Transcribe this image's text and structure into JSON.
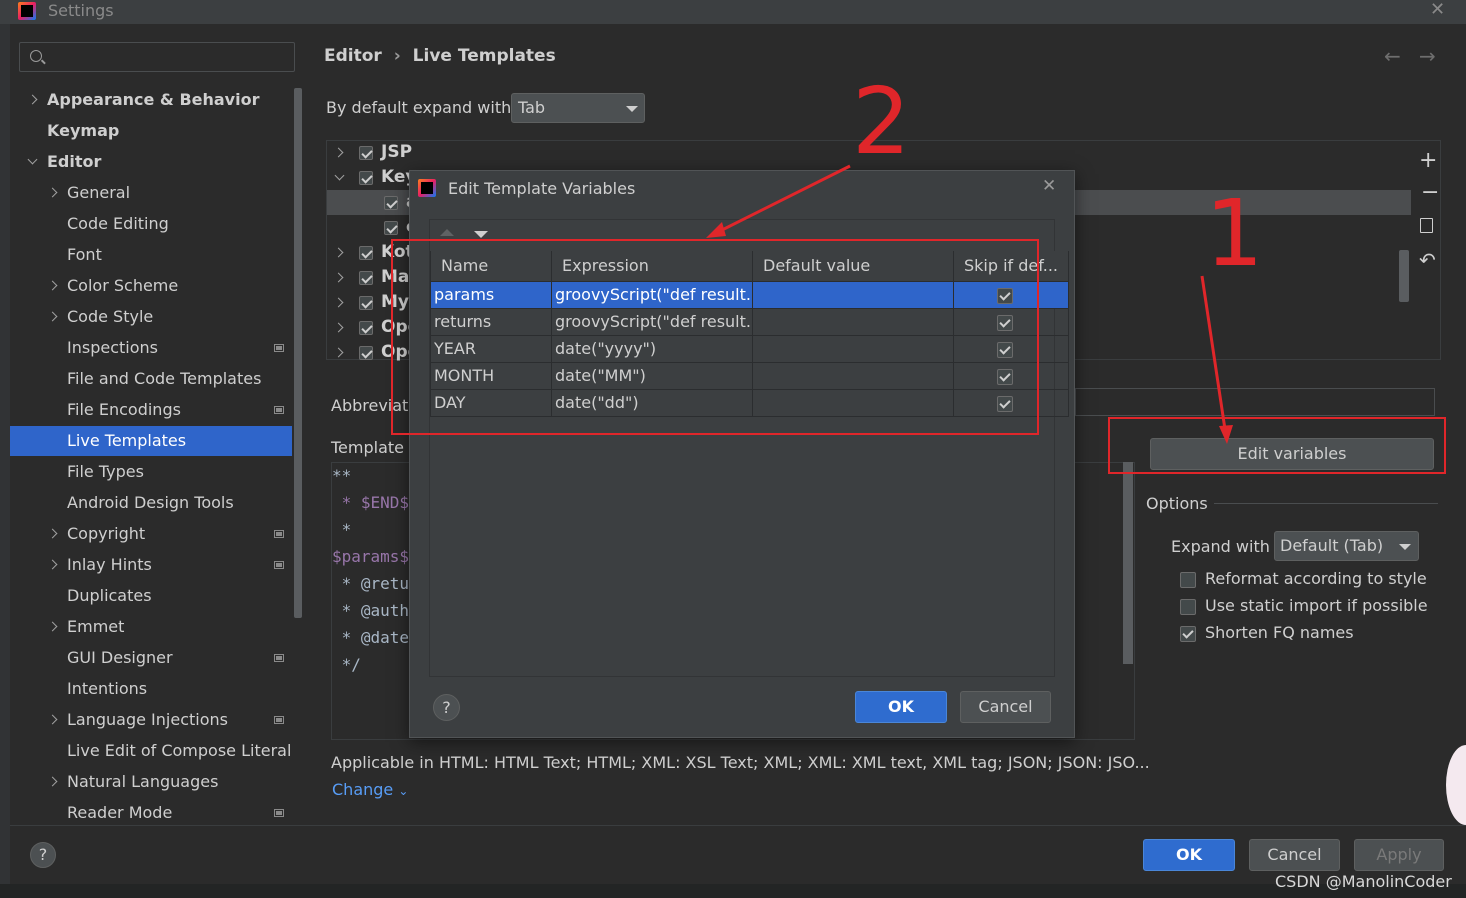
{
  "window": {
    "title": "Settings"
  },
  "search": {
    "placeholder": ""
  },
  "breadcrumb": {
    "parent": "Editor",
    "separator": "›",
    "current": "Live Templates"
  },
  "sidebar": {
    "items": [
      {
        "label": "Appearance & Behavior",
        "bold": true,
        "chevron": "right",
        "indent": 0
      },
      {
        "label": "Keymap",
        "bold": true,
        "chevron": "none",
        "indent": 0
      },
      {
        "label": "Editor",
        "bold": true,
        "chevron": "down",
        "indent": 0
      },
      {
        "label": "General",
        "chevron": "right",
        "indent": 1
      },
      {
        "label": "Code Editing",
        "chevron": "none",
        "indent": 1
      },
      {
        "label": "Font",
        "chevron": "none",
        "indent": 1
      },
      {
        "label": "Color Scheme",
        "chevron": "right",
        "indent": 1
      },
      {
        "label": "Code Style",
        "chevron": "right",
        "indent": 1
      },
      {
        "label": "Inspections",
        "chevron": "none",
        "indent": 1,
        "project_icon": true
      },
      {
        "label": "File and Code Templates",
        "chevron": "none",
        "indent": 1
      },
      {
        "label": "File Encodings",
        "chevron": "none",
        "indent": 1,
        "project_icon": true
      },
      {
        "label": "Live Templates",
        "chevron": "none",
        "indent": 1,
        "selected": true
      },
      {
        "label": "File Types",
        "chevron": "none",
        "indent": 1
      },
      {
        "label": "Android Design Tools",
        "chevron": "none",
        "indent": 1
      },
      {
        "label": "Copyright",
        "chevron": "right",
        "indent": 1,
        "project_icon": true
      },
      {
        "label": "Inlay Hints",
        "chevron": "right",
        "indent": 1,
        "project_icon": true
      },
      {
        "label": "Duplicates",
        "chevron": "none",
        "indent": 1
      },
      {
        "label": "Emmet",
        "chevron": "right",
        "indent": 1
      },
      {
        "label": "GUI Designer",
        "chevron": "none",
        "indent": 1,
        "project_icon": true
      },
      {
        "label": "Intentions",
        "chevron": "none",
        "indent": 1
      },
      {
        "label": "Language Injections",
        "chevron": "right",
        "indent": 1,
        "project_icon": true
      },
      {
        "label": "Live Edit of Compose Literals",
        "chevron": "none",
        "indent": 1
      },
      {
        "label": "Natural Languages",
        "chevron": "right",
        "indent": 1
      },
      {
        "label": "Reader Mode",
        "chevron": "none",
        "indent": 1,
        "project_icon": true
      }
    ]
  },
  "expand_default": {
    "label": "By default expand with",
    "value": "Tab"
  },
  "template_groups": [
    {
      "label": "JSP",
      "checked": true,
      "expanded": false
    },
    {
      "label": "Key",
      "checked": true,
      "expanded": true
    },
    {
      "label": "a",
      "checked": true,
      "child": true,
      "selected": true
    },
    {
      "label": "c",
      "checked": true,
      "child": true
    },
    {
      "label": "Kot",
      "checked": true,
      "expanded": false
    },
    {
      "label": "Ma",
      "checked": true,
      "expanded": false
    },
    {
      "label": "My",
      "checked": true,
      "expanded": false
    },
    {
      "label": "Ope",
      "checked": true,
      "expanded": false
    },
    {
      "label": "Ope",
      "checked": true,
      "expanded": false
    }
  ],
  "abbreviation_label": "Abbreviati",
  "template_text_label": "Template t",
  "template_code": [
    {
      "text": "**",
      "color": "#a9b7c6"
    },
    {
      "text": " * $END$",
      "color": "#9876aa"
    },
    {
      "text": " *",
      "color": "#a9b7c6"
    },
    {
      "text": "$params$",
      "color": "#9876aa"
    },
    {
      "text": " * @retu",
      "color": "#a9b7c6"
    },
    {
      "text": " * @auth",
      "color": "#a9b7c6"
    },
    {
      "text": " * @date",
      "color": "#a9b7c6"
    },
    {
      "text": " */",
      "color": "#a9b7c6"
    }
  ],
  "edit_variables_button": "Edit variables",
  "options": {
    "title": "Options",
    "expand_label": "Expand with",
    "expand_value": "Default (Tab)",
    "checkboxes": [
      {
        "label": "Reformat according to style",
        "checked": false
      },
      {
        "label": "Use static import if possible",
        "checked": false
      },
      {
        "label": "Shorten FQ names",
        "checked": true
      }
    ]
  },
  "applicable": {
    "text": "Applicable in HTML: HTML Text; HTML; XML: XSL Text; XML; XML: XML text, XML tag; JSON; JSON: JSO...",
    "change_link": "Change"
  },
  "dialog": {
    "title": "Edit Template Variables",
    "columns": [
      "Name",
      "Expression",
      "Default value",
      "Skip if def..."
    ],
    "rows": [
      {
        "name": "params",
        "expression": "groovyScript(\"def result...",
        "default": "",
        "skip": true,
        "selected": true
      },
      {
        "name": "returns",
        "expression": "groovyScript(\"def result...",
        "default": "",
        "skip": true
      },
      {
        "name": "YEAR",
        "expression": "date(\"yyyy\")",
        "default": "",
        "skip": true
      },
      {
        "name": "MONTH",
        "expression": "date(\"MM\")",
        "default": "",
        "skip": true
      },
      {
        "name": "DAY",
        "expression": "date(\"dd\")",
        "default": "",
        "skip": true
      }
    ],
    "ok": "OK",
    "cancel": "Cancel",
    "help": "?"
  },
  "footer": {
    "ok": "OK",
    "cancel": "Cancel",
    "apply": "Apply",
    "help": "?"
  },
  "annotations": {
    "one": "1",
    "two": "2"
  },
  "watermark": "CSDN @ManolinCoder",
  "colors": {
    "accent": "#2f65ca",
    "annotation_red": "#e0262a",
    "background": "#2b2b2b",
    "dialog_bg": "#3c3f41"
  }
}
